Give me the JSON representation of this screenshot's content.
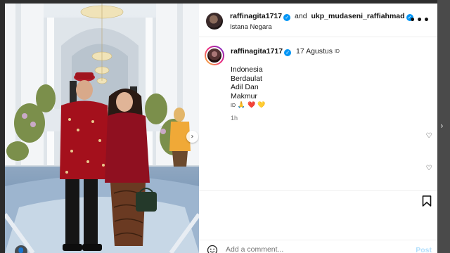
{
  "post": {
    "author": "raffinagita1717",
    "and_text": "and",
    "collaborator": "ukp_mudaseni_raffiahmad",
    "location": "Istana Negara",
    "more_label": "•••"
  },
  "caption": {
    "author": "raffinagita1717",
    "date": "17 Agustus",
    "id_tag": "ID",
    "lines": [
      "Indonesia",
      "Berdaulat",
      "Adil Dan",
      "Makmur"
    ],
    "emoji_line": "🙏 ❤️ 💛",
    "time_ago": "1h"
  },
  "comment": {
    "placeholder": "Add a comment...",
    "post_label": "Post"
  },
  "icons": {
    "verified": "verified-badge-icon",
    "heart": "heart-icon",
    "save": "bookmark-icon",
    "emoji": "emoji-icon",
    "next": "chevron-right-icon",
    "tag": "person-tag-icon"
  },
  "colors": {
    "verified_blue": "#0095f6",
    "post_disabled": "#b2dffc"
  }
}
